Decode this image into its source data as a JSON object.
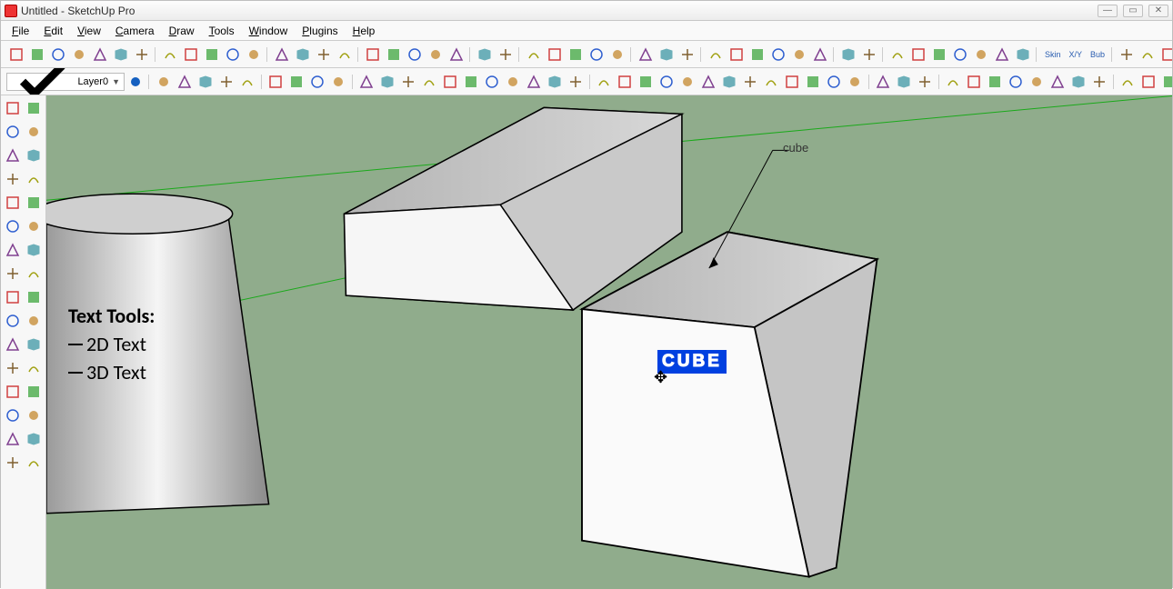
{
  "window": {
    "title": "Untitled - SketchUp Pro"
  },
  "menu": [
    "File",
    "Edit",
    "View",
    "Camera",
    "Draw",
    "Tools",
    "Window",
    "Plugins",
    "Help"
  ],
  "layer": {
    "name": "Layer0"
  },
  "toolbar_text": {
    "skin": "Skin",
    "xy": "X/Y",
    "bub": "Bub"
  },
  "toolbar_row1_icons": [
    "rect-outline",
    "rect-solid",
    "rect-dashed",
    "cube-wire",
    "cube-shaded",
    "cube-solid",
    "cube-dashed",
    "iso",
    "top",
    "front",
    "side",
    "persp",
    "circle-arcs",
    "arc",
    "arc2",
    "half-arc",
    "extrude",
    "extrude-curve",
    "loft",
    "sweep",
    "sweep2",
    "line",
    "freehand",
    "rotate",
    "scale",
    "move",
    "copy",
    "follow-me",
    "tape",
    "protractor",
    "axes",
    "section-a",
    "section-b",
    "section-c",
    "section-d",
    "section-e",
    "section-f",
    "eye",
    "orbit",
    "hatch-a",
    "hatch-b",
    "hatch-c",
    "hatch-d",
    "hatch-e",
    "hatch-f",
    "hatch-g",
    "stop",
    "play",
    "stop-rec",
    "question",
    "tree-a",
    "tree-b",
    "tree-c",
    "shrub"
  ],
  "toolbar_row2_icons": [
    "world",
    "hand",
    "cube-add",
    "cube-sub",
    "zoom-extents",
    "box-red",
    "axes2",
    "tick",
    "dim",
    "m-yellow",
    "arrow-green",
    "r-blue",
    "rt-cyan",
    "bb-blue",
    "sun",
    "layers",
    "calc",
    "poly1",
    "poly2",
    "globe",
    "info",
    "align-a",
    "align-b",
    "align-c",
    "align-d",
    "align-e",
    "align-f",
    "align-g",
    "align-h",
    "align-i",
    "align-j",
    "align-k",
    "align-l",
    "align-m",
    "person",
    "chart",
    "fence",
    "plane-a",
    "plane-b",
    "plane-c",
    "plane-d",
    "plane-e",
    "plane-f",
    "plane-g",
    "plane-h",
    "box-color",
    "cyl-color",
    "sphere-color"
  ],
  "vertical_tools": [
    [
      "select-arrow",
      "paint-bucket"
    ],
    [
      "pencil",
      "eraser"
    ],
    [
      "rectangle",
      "freehand-red"
    ],
    [
      "circle",
      "wave"
    ],
    [
      "polygon",
      "arc-red"
    ],
    [
      "push-pull",
      "follow-me-red"
    ],
    [
      "move-red",
      "rotate-red"
    ],
    [
      "offset",
      "scale-red"
    ],
    [
      "tape-measure",
      "dimension"
    ],
    [
      "protractor2",
      "text-label"
    ],
    [
      "axes-tool",
      "3d-text"
    ],
    [
      "orbit2",
      "pan"
    ],
    [
      "zoom",
      "zoom-window"
    ],
    [
      "zoom-extents2",
      "prev-view"
    ],
    [
      "walk",
      "look"
    ],
    [
      "position",
      "section"
    ]
  ],
  "annotation": {
    "heading": "Text Tools:",
    "line1": "2D Text",
    "line2": "3D Text"
  },
  "scene": {
    "leader_label": "cube",
    "text3d": "CUBE"
  }
}
